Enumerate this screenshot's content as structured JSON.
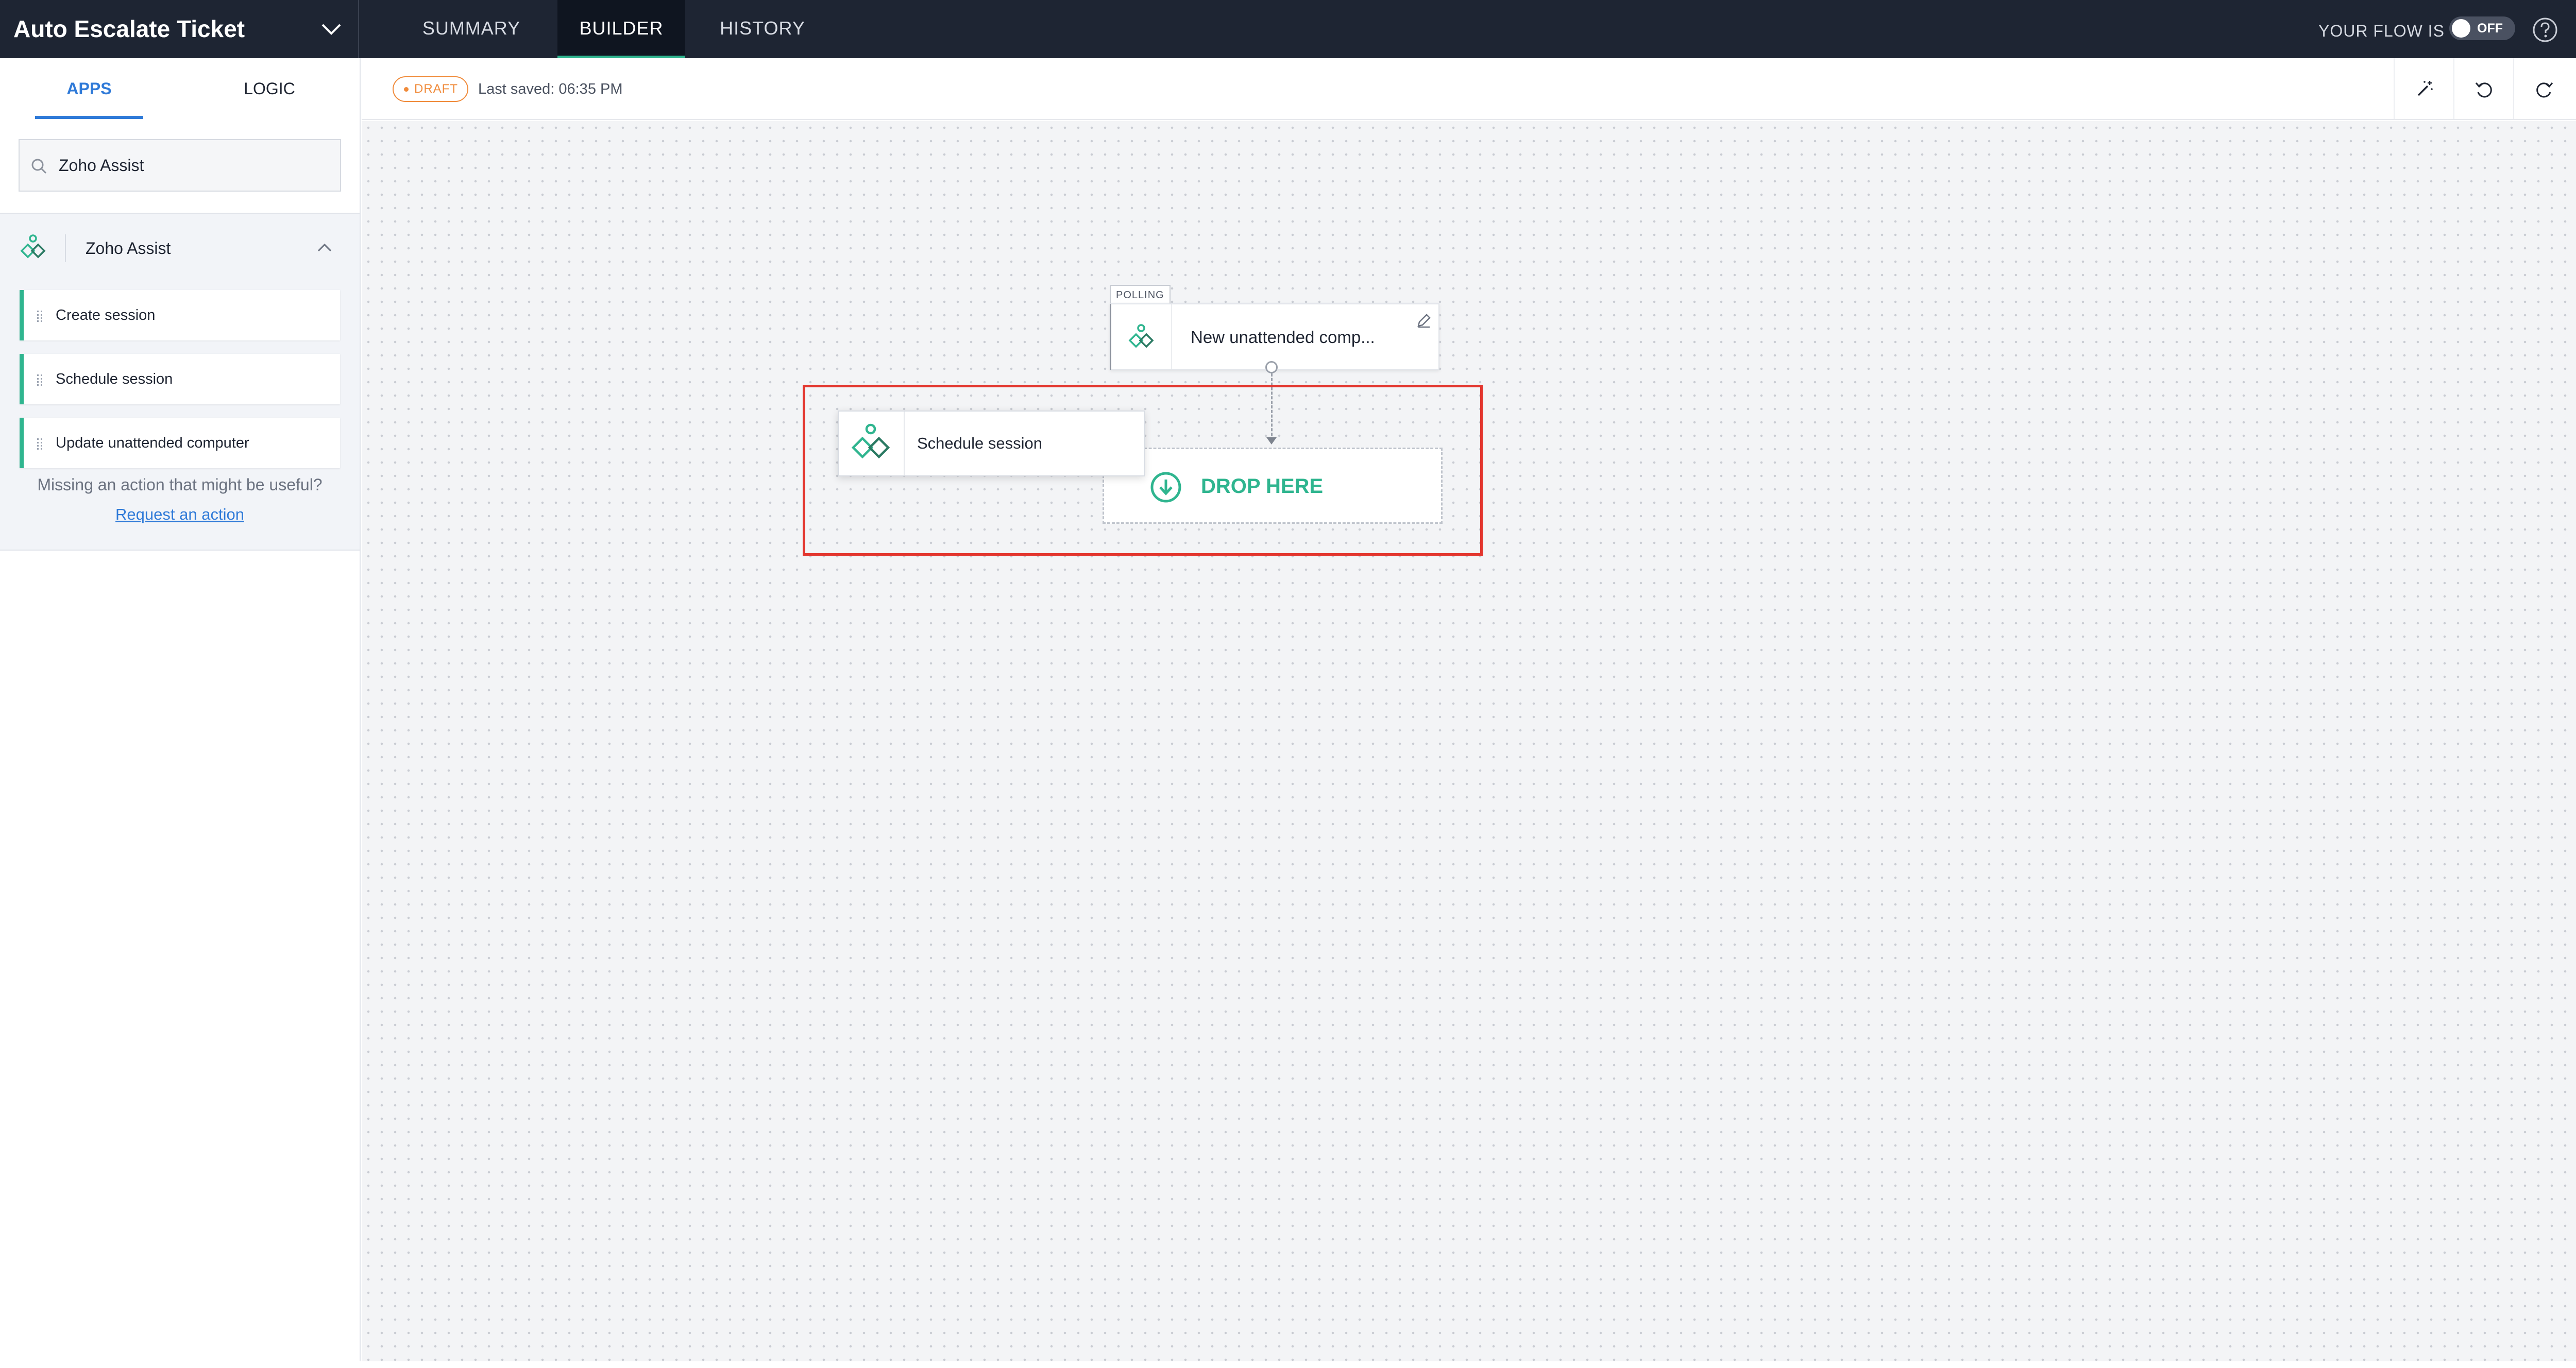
{
  "header": {
    "flow_name": "Auto Escalate Ticket",
    "tabs": [
      {
        "label": "SUMMARY",
        "active": false
      },
      {
        "label": "BUILDER",
        "active": true
      },
      {
        "label": "HISTORY",
        "active": false
      }
    ],
    "flow_status_label": "YOUR FLOW IS",
    "toggle_label": "OFF",
    "toggle_on": false
  },
  "sidebar": {
    "tabs": [
      {
        "label": "APPS",
        "active": true
      },
      {
        "label": "LOGIC",
        "active": false
      }
    ],
    "search_value": "Zoho Assist",
    "app": {
      "name": "Zoho Assist",
      "expanded": true,
      "actions": [
        {
          "label": "Create session"
        },
        {
          "label": "Schedule session"
        },
        {
          "label": "Update unattended computer"
        }
      ]
    },
    "missing_text": "Missing an action that might be useful?",
    "request_link": "Request an action"
  },
  "toolbar": {
    "draft_label": "DRAFT",
    "saved_text": "Last saved: 06:35 PM",
    "buttons": [
      "magic-wand-icon",
      "undo-icon",
      "redo-icon",
      "play-icon"
    ]
  },
  "canvas": {
    "trigger": {
      "tag": "POLLING",
      "label": "New unattended comp..."
    },
    "drop_zone_label": "DROP HERE",
    "dragging_card_label": "Schedule session"
  },
  "colors": {
    "topbar": "#1e2533",
    "accent_green": "#2fb58f",
    "accent_blue": "#2f7ad8",
    "draft_orange": "#f08b3b",
    "highlight_red": "#e3362e"
  }
}
